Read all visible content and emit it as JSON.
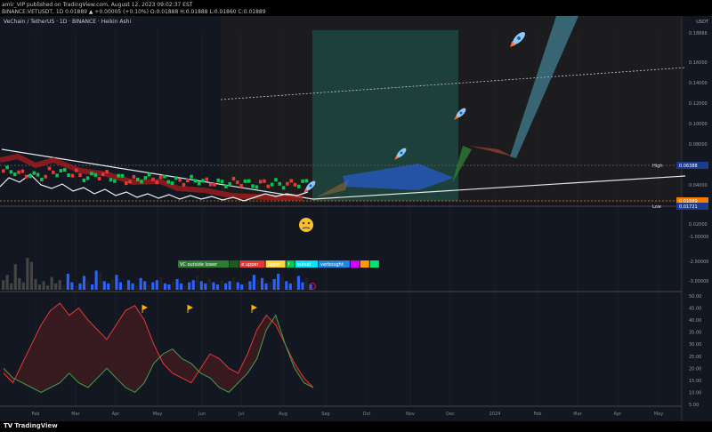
{
  "header": {
    "line1": "amir_VIP published on TradingView.com, August 12, 2023 09:02:37 EST",
    "line2": "BINANCE:VETUSDT, 1D 0.01889 ▲ +0.00005 (+0.10%) O:0.01888 H:0.01888 L:0.01860 C:0.01889"
  },
  "chart_title": "VeChain / TetherUS · 1D · BINANCE · Heikin Ashi",
  "currency_label": "USDT",
  "branding": "TradingView",
  "colors": {
    "background": "#131722",
    "bull": "#26a69a",
    "bear": "#ef5350",
    "projection_zone": "#1e4d44",
    "arrow_blue": "#2962ff",
    "arrow_green": "#2e7d32",
    "arrow_brown": "#8d3b2f",
    "oscillator_red": "#e53935",
    "oscillator_green": "#43a047"
  },
  "chart_data": [
    {
      "type": "line",
      "name": "price",
      "x_ticks": [
        "Feb",
        "Mar",
        "Apr",
        "May",
        "Jun",
        "Jul",
        "Aug",
        "Sep",
        "Oct",
        "Nov",
        "Dec",
        "2024",
        "Feb",
        "Mar",
        "Apr",
        "May"
      ],
      "y_ticks": [
        "0.18866",
        "0.16000",
        "0.14000",
        "0.12000",
        "0.10000",
        "0.08000",
        "0.06000",
        "0.04000",
        "0.02000",
        "0.00000"
      ],
      "badges": [
        {
          "label": "High",
          "value": "0.06388",
          "color": "#1e3a8a"
        },
        {
          "label": "",
          "value": "0.01889",
          "color": "#f57c00"
        },
        {
          "label": "Low",
          "value": "0.01721",
          "color": "#1e3a8a"
        }
      ],
      "price_series": [
        0.031,
        0.028,
        0.026,
        0.03,
        0.029,
        0.025,
        0.027,
        0.024,
        0.022,
        0.024,
        0.023,
        0.021,
        0.022,
        0.02,
        0.019,
        0.02,
        0.018,
        0.019,
        0.018,
        0.0189
      ],
      "projection_path": [
        0.019,
        0.036,
        0.04,
        0.045,
        0.048,
        0.05,
        0.043,
        0.081,
        0.091,
        0.083,
        0.19
      ],
      "grid": true
    },
    {
      "type": "bar",
      "name": "volume",
      "y_ticks": [
        "-1.00000",
        "-2.00000",
        "-3.00000"
      ],
      "legend": [
        {
          "text": "VC outside lower",
          "color": "#2e7d32"
        },
        {
          "text": "",
          "color": "#1b5e20"
        },
        {
          "text": "e upper",
          "color": "#e53935"
        },
        {
          "text": "upper",
          "color": "#fdd835"
        },
        {
          "text": "f",
          "color": "#00c853"
        },
        {
          "text": "outsid",
          "color": "#00e5ff"
        },
        {
          "text": "verbought",
          "color": "#1e88e5"
        },
        {
          "text": "",
          "color": "#d500f9"
        },
        {
          "text": "",
          "color": "#ff9800"
        },
        {
          "text": "",
          "color": "#00e676"
        }
      ],
      "values": [
        0.9,
        1.4,
        0.6,
        2.4,
        1.1,
        0.7,
        3.0,
        2.6,
        1.0,
        0.5,
        0.8,
        0.4,
        1.2,
        0.6,
        0.9,
        0.5,
        1.5,
        0.7,
        0.4,
        0.6,
        1.3,
        0.9,
        0.5,
        1.8,
        1.6,
        0.8,
        0.6,
        1.0,
        1.4,
        0.7,
        0.5,
        0.9,
        0.6,
        0.4,
        1.1,
        0.8,
        0.5,
        0.7,
        0.9,
        1.2,
        0.6,
        0.5,
        0.8,
        1.0,
        0.6,
        0.4,
        0.7,
        0.9,
        1.3,
        0.8,
        0.6,
        1.1,
        0.7,
        0.5,
        0.9,
        0.6,
        0.8,
        1.2,
        0.7,
        0.5,
        0.6,
        0.8,
        1.4,
        0.9,
        1.1,
        0.6,
        0.7,
        1.0,
        1.5,
        1.2,
        0.8,
        0.6,
        0.9,
        1.3,
        0.7,
        1.1,
        0.5
      ]
    },
    {
      "type": "line",
      "name": "oscillator",
      "y_ticks": [
        "50.00",
        "45.00",
        "40.00",
        "35.00",
        "30.00",
        "25.00",
        "20.00",
        "15.00",
        "10.00",
        "5.00"
      ],
      "ylim": [
        5,
        50
      ],
      "series": [
        {
          "name": "",
          "color": "#e53935",
          "values": [
            18,
            14,
            22,
            30,
            38,
            44,
            47,
            42,
            45,
            40,
            36,
            32,
            38,
            44,
            46,
            40,
            30,
            22,
            18,
            16,
            14,
            20,
            26,
            24,
            20,
            18,
            26,
            36,
            42,
            38,
            30,
            22,
            16,
            12
          ]
        },
        {
          "name": "",
          "color": "#43a047",
          "values": [
            20,
            16,
            14,
            12,
            10,
            12,
            14,
            18,
            14,
            12,
            16,
            20,
            16,
            12,
            10,
            14,
            22,
            26,
            28,
            24,
            22,
            18,
            16,
            12,
            10,
            14,
            18,
            24,
            36,
            42,
            30,
            20,
            14,
            12
          ]
        }
      ]
    }
  ]
}
